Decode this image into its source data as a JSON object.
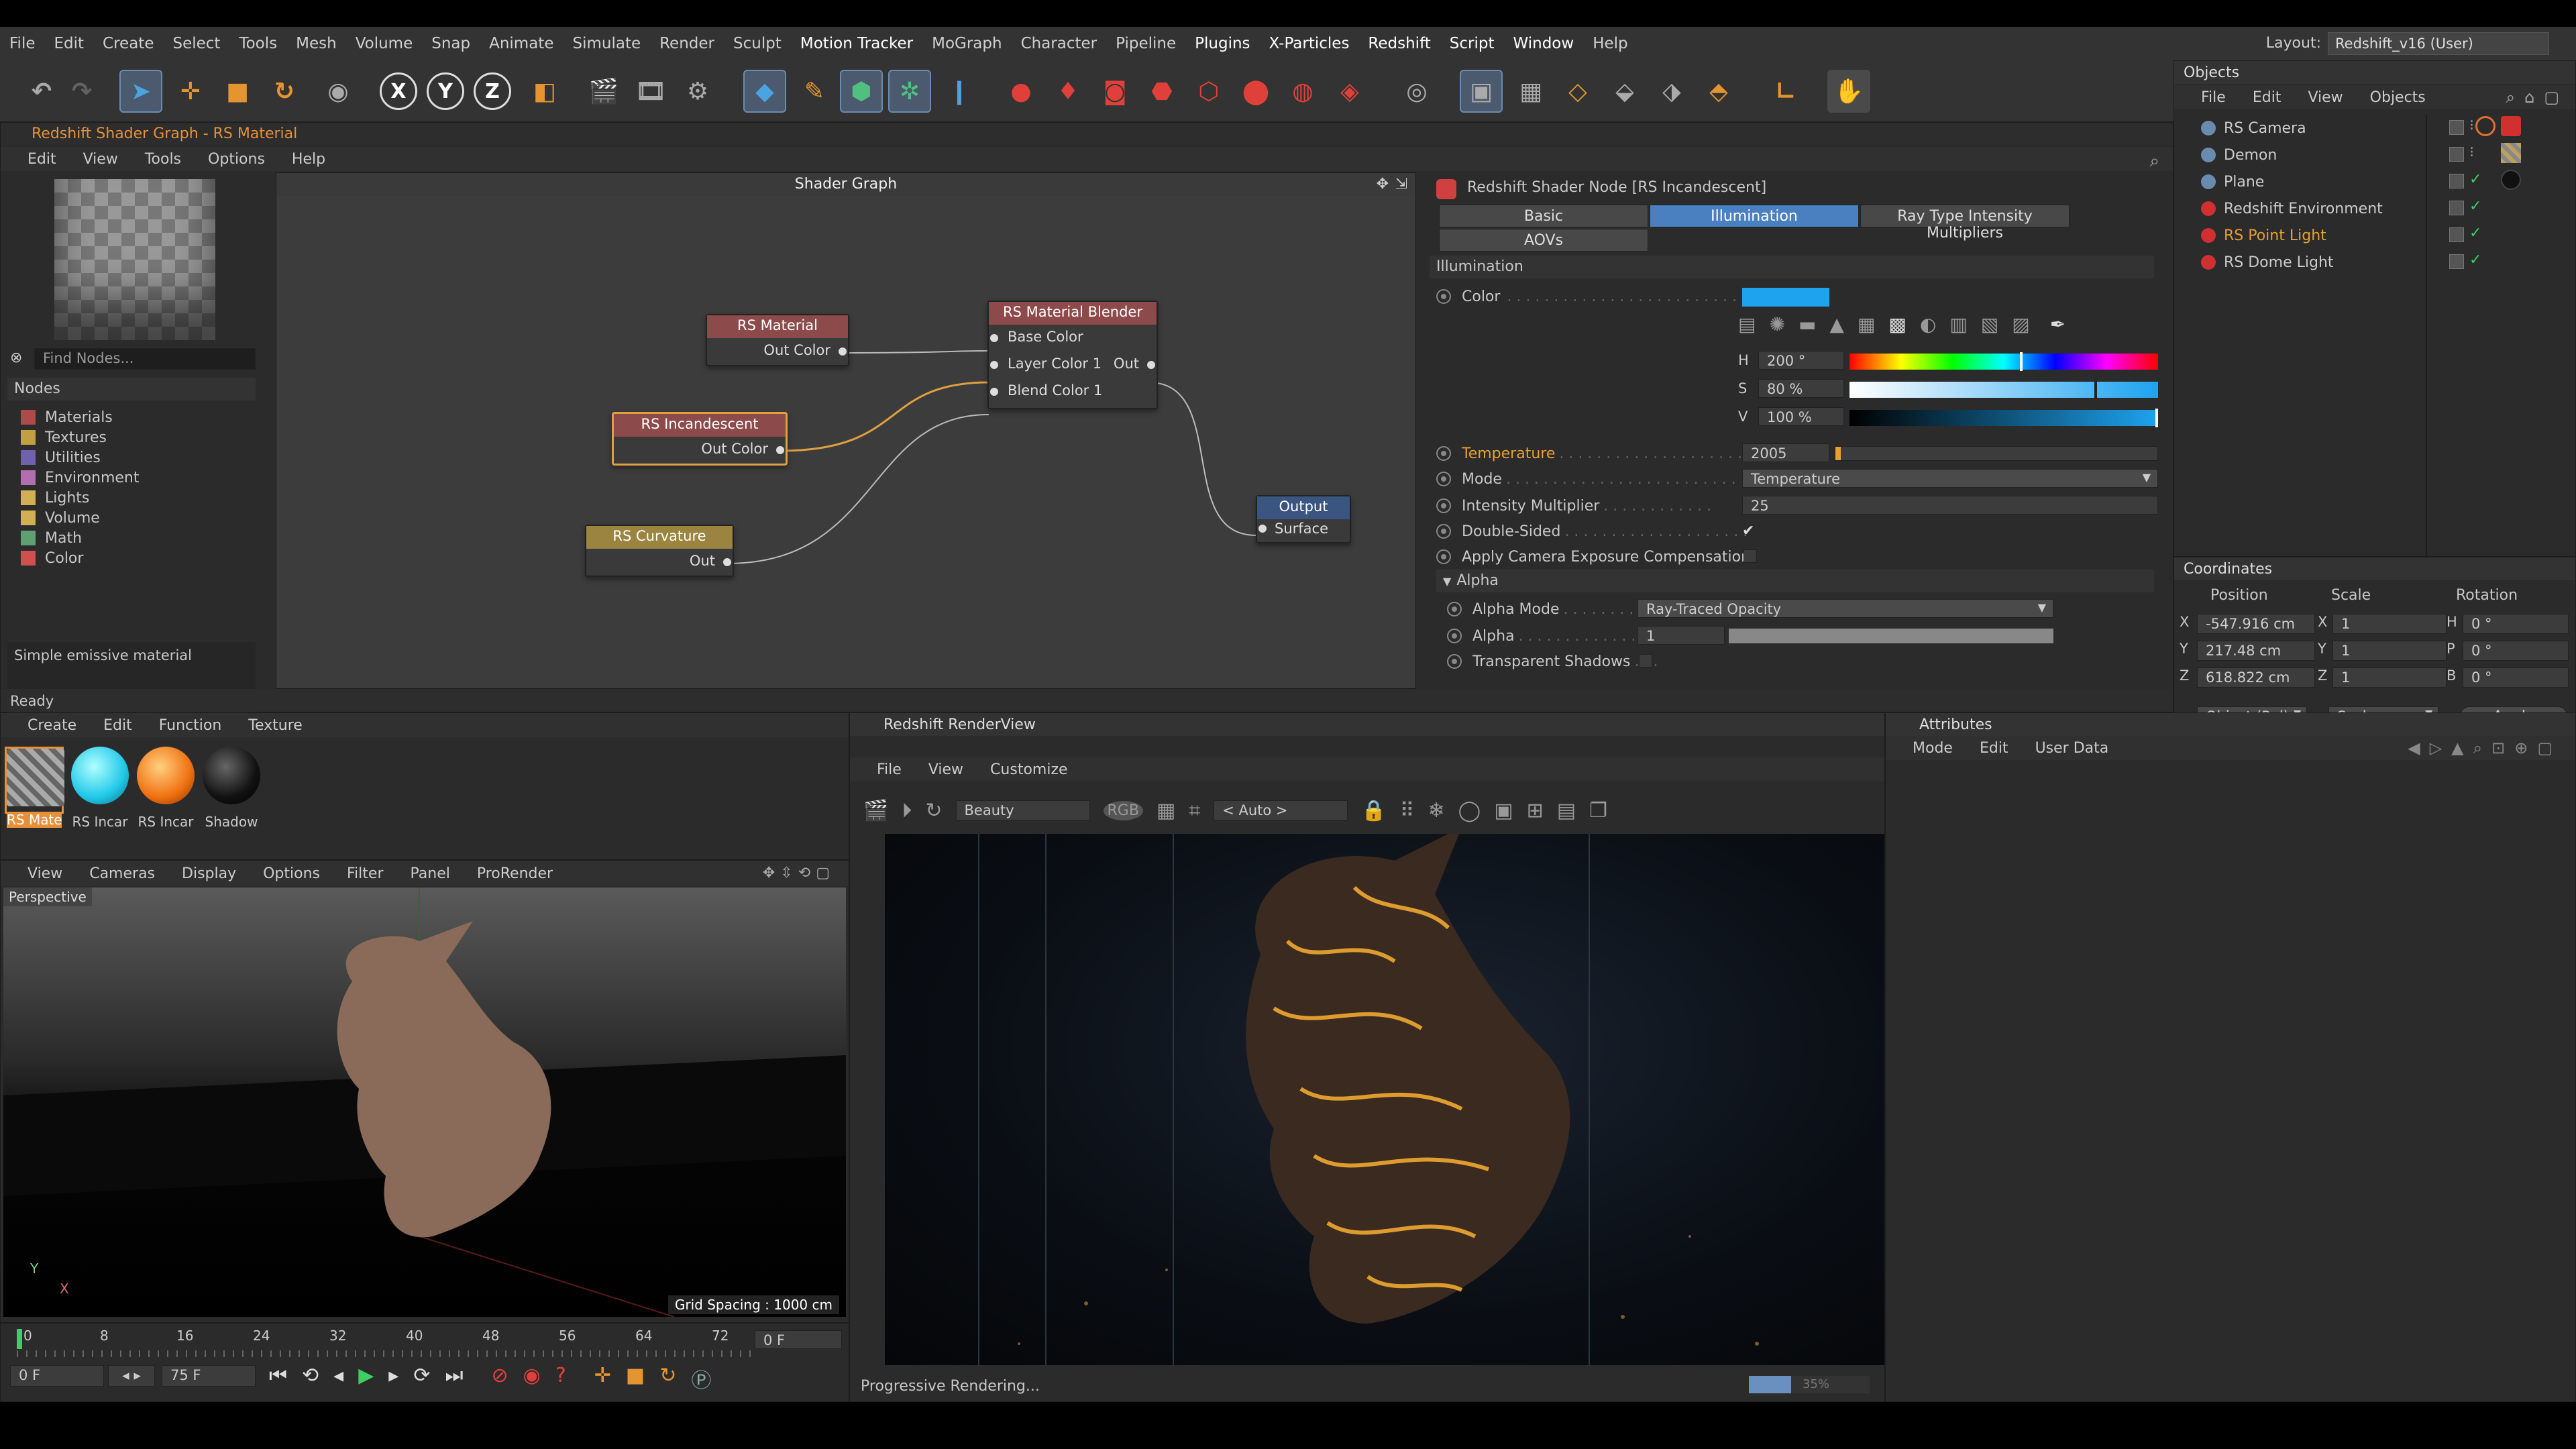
{
  "menu": [
    "File",
    "Edit",
    "Create",
    "Select",
    "Tools",
    "Mesh",
    "Volume",
    "Snap",
    "Animate",
    "Simulate",
    "Render",
    "Sculpt",
    "Motion Tracker",
    "MoGraph",
    "Character",
    "Pipeline",
    "Plugins",
    "X-Particles",
    "Redshift",
    "Script",
    "Window",
    "Help"
  ],
  "layout": {
    "label": "Layout:",
    "value": "Redshift_v16 (User)"
  },
  "toolbar": {
    "axis_x": "X",
    "axis_y": "Y",
    "axis_z": "Z"
  },
  "shader_window": {
    "title": "Redshift Shader Graph - RS Material",
    "menu": [
      "Edit",
      "View",
      "Tools",
      "Options",
      "Help"
    ],
    "graph_title": "Shader Graph",
    "find_placeholder": "Find Nodes...",
    "nodes_header": "Nodes",
    "categories": [
      {
        "label": "Materials",
        "color": "#b04a4a"
      },
      {
        "label": "Textures",
        "color": "#c0a040"
      },
      {
        "label": "Utilities",
        "color": "#7060b0"
      },
      {
        "label": "Environment",
        "color": "#b070b0"
      },
      {
        "label": "Lights",
        "color": "#d0b050"
      },
      {
        "label": "Volume",
        "color": "#d0b050"
      },
      {
        "label": "Math",
        "color": "#60a070"
      },
      {
        "label": "Color",
        "color": "#d05050"
      }
    ],
    "description": "Simple emissive material",
    "graph_nodes": {
      "rs_material": {
        "title": "RS Material",
        "port": "Out Color"
      },
      "rs_incandescent": {
        "title": "RS Incandescent",
        "port": "Out Color"
      },
      "rs_curvature": {
        "title": "RS Curvature",
        "port": "Out"
      },
      "blender": {
        "title": "RS Material Blender",
        "ports": [
          "Base Color",
          "Layer Color 1",
          "Blend Color 1"
        ],
        "out": "Out"
      },
      "output": {
        "title": "Output",
        "port": "Surface"
      }
    }
  },
  "node_props": {
    "title": "Redshift Shader Node [RS Incandescent]",
    "tabs": [
      "Basic",
      "Illumination",
      "Ray Type Intensity Multipliers",
      "AOVs"
    ],
    "active_tab": "Illumination",
    "section": "Illumination",
    "color_label": "Color",
    "color_value": "#1ea3ef",
    "h_label": "H",
    "h_value": "200 °",
    "s_label": "S",
    "s_value": "80 %",
    "v_label": "V",
    "v_value": "100 %",
    "h_pos": 0.556,
    "s_pos": 0.8,
    "v_pos": 1.0,
    "temperature_label": "Temperature",
    "temperature_value": "2005",
    "mode_label": "Mode",
    "mode_value": "Temperature",
    "intensity_label": "Intensity Multiplier",
    "intensity_value": "25",
    "double_sided_label": "Double-Sided",
    "double_sided_check": "✔",
    "camera_exposure_label": "Apply Camera Exposure Compensation",
    "alpha_section": "Alpha",
    "alpha_mode_label": "Alpha Mode",
    "alpha_mode_value": "Ray-Traced Opacity",
    "alpha_label": "Alpha",
    "alpha_value": "1",
    "transparent_shadows_label": "Transparent Shadows"
  },
  "status": "Ready",
  "objects": {
    "title": "Objects",
    "menu": [
      "File",
      "Edit",
      "View",
      "Objects"
    ],
    "items": [
      {
        "name": "RS Camera",
        "color": "#ccc"
      },
      {
        "name": "Demon",
        "color": "#ccc"
      },
      {
        "name": "Plane",
        "color": "#ccc"
      },
      {
        "name": "Redshift Environment",
        "color": "#ccc"
      },
      {
        "name": "RS Point Light",
        "color": "#e8a030"
      },
      {
        "name": "RS Dome Light",
        "color": "#ccc"
      }
    ]
  },
  "coordinates": {
    "title": "Coordinates",
    "headers": [
      "Position",
      "Scale",
      "Rotation"
    ],
    "rows": [
      {
        "axis": "X",
        "pos": "-547.916 cm",
        "saxis": "X",
        "scale": "1",
        "raxis": "H",
        "rot": "0 °"
      },
      {
        "axis": "Y",
        "pos": "217.48 cm",
        "saxis": "Y",
        "scale": "1",
        "raxis": "P",
        "rot": "0 °"
      },
      {
        "axis": "Z",
        "pos": "618.822 cm",
        "saxis": "Z",
        "scale": "1",
        "raxis": "B",
        "rot": "0 °"
      }
    ],
    "mode": "Object (Rel)",
    "scale_mode": "Scale",
    "apply": "Apply"
  },
  "materials": {
    "menu": [
      "Create",
      "Edit",
      "Function",
      "Texture"
    ],
    "items": [
      {
        "label": "RS Mate"
      },
      {
        "label": "RS Incar"
      },
      {
        "label": "RS Incar"
      },
      {
        "label": "Shadow"
      }
    ]
  },
  "viewport": {
    "menu": [
      "View",
      "Cameras",
      "Display",
      "Options",
      "Filter",
      "Panel",
      "ProRender"
    ],
    "label": "Perspective",
    "grid_spacing": "Grid Spacing : 1000 cm"
  },
  "timeline": {
    "ticks": [
      "0",
      "8",
      "16",
      "24",
      "32",
      "40",
      "48",
      "56",
      "64",
      "72"
    ],
    "frame_field": "0 F",
    "start": "0 F",
    "end": "75 F"
  },
  "renderview": {
    "title": "Redshift RenderView",
    "menu": [
      "File",
      "View",
      "Customize"
    ],
    "aov": "Beauty",
    "rgb": "RGB",
    "auto": "< Auto >",
    "status": "Progressive Rendering...",
    "progress": 0.35,
    "progress_text": "35%"
  },
  "attributes": {
    "title": "Attributes",
    "menu": [
      "Mode",
      "Edit",
      "User Data"
    ]
  }
}
